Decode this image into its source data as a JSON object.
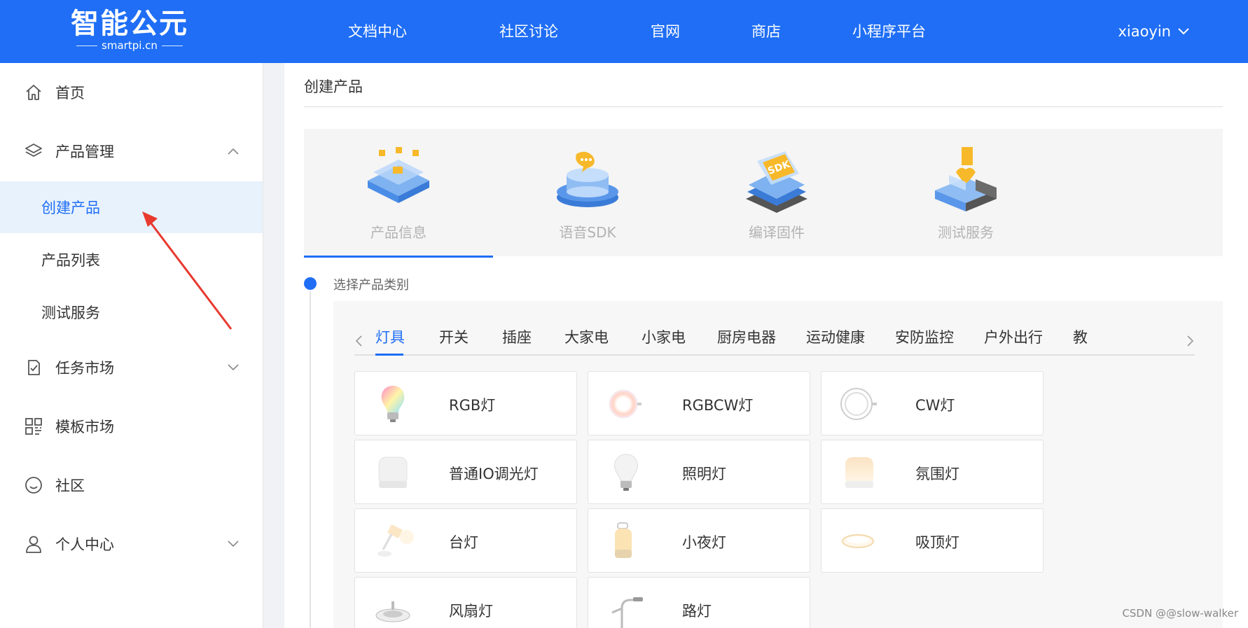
{
  "brand": {
    "logo_main": "智能公元",
    "logo_sub": "smartpi.cn"
  },
  "topnav": {
    "items": [
      {
        "label": "文档中心"
      },
      {
        "label": "社区讨论"
      },
      {
        "label": "官网"
      },
      {
        "label": "商店"
      },
      {
        "label": "小程序平台"
      }
    ],
    "username": "xiaoyin"
  },
  "sidebar": {
    "home": "首页",
    "product_mgmt": "产品管理",
    "sub_items": [
      {
        "label": "创建产品",
        "active": true
      },
      {
        "label": "产品列表",
        "active": false
      },
      {
        "label": "测试服务",
        "active": false
      }
    ],
    "task_market": "任务市场",
    "template_market": "模板市场",
    "community": "社区",
    "personal_center": "个人中心"
  },
  "main": {
    "page_title": "创建产品",
    "steps": [
      {
        "label": "产品信息",
        "icon": "product-info-icon",
        "active": true
      },
      {
        "label": "语音SDK",
        "icon": "voice-sdk-icon",
        "active": false
      },
      {
        "label": "编译固件",
        "icon": "compile-firmware-icon",
        "active": false
      },
      {
        "label": "测试服务",
        "icon": "test-service-icon",
        "active": false
      }
    ],
    "sdk_badge": "SDK",
    "section_label": "选择产品类别",
    "category_tabs": [
      "灯具",
      "开关",
      "插座",
      "大家电",
      "小家电",
      "厨房电器",
      "运动健康",
      "安防监控",
      "户外出行",
      "教"
    ],
    "active_tab": "灯具",
    "products": [
      {
        "label": "RGB灯",
        "icon": "rgb-bulb-icon"
      },
      {
        "label": "RGBCW灯",
        "icon": "rgbcw-light-icon"
      },
      {
        "label": "CW灯",
        "icon": "cw-ring-light-icon"
      },
      {
        "label": "普通IO调光灯",
        "icon": "io-dimmer-light-icon"
      },
      {
        "label": "照明灯",
        "icon": "lighting-bulb-icon"
      },
      {
        "label": "氛围灯",
        "icon": "ambient-light-icon"
      },
      {
        "label": "台灯",
        "icon": "desk-lamp-icon"
      },
      {
        "label": "小夜灯",
        "icon": "night-light-icon"
      },
      {
        "label": "吸顶灯",
        "icon": "ceiling-light-icon"
      },
      {
        "label": "风扇灯",
        "icon": "fan-light-icon"
      },
      {
        "label": "路灯",
        "icon": "street-light-icon"
      }
    ]
  },
  "watermark": "CSDN @@slow-walker",
  "colors": {
    "primary": "#1f6ef5",
    "annotation": "#e8392f"
  }
}
